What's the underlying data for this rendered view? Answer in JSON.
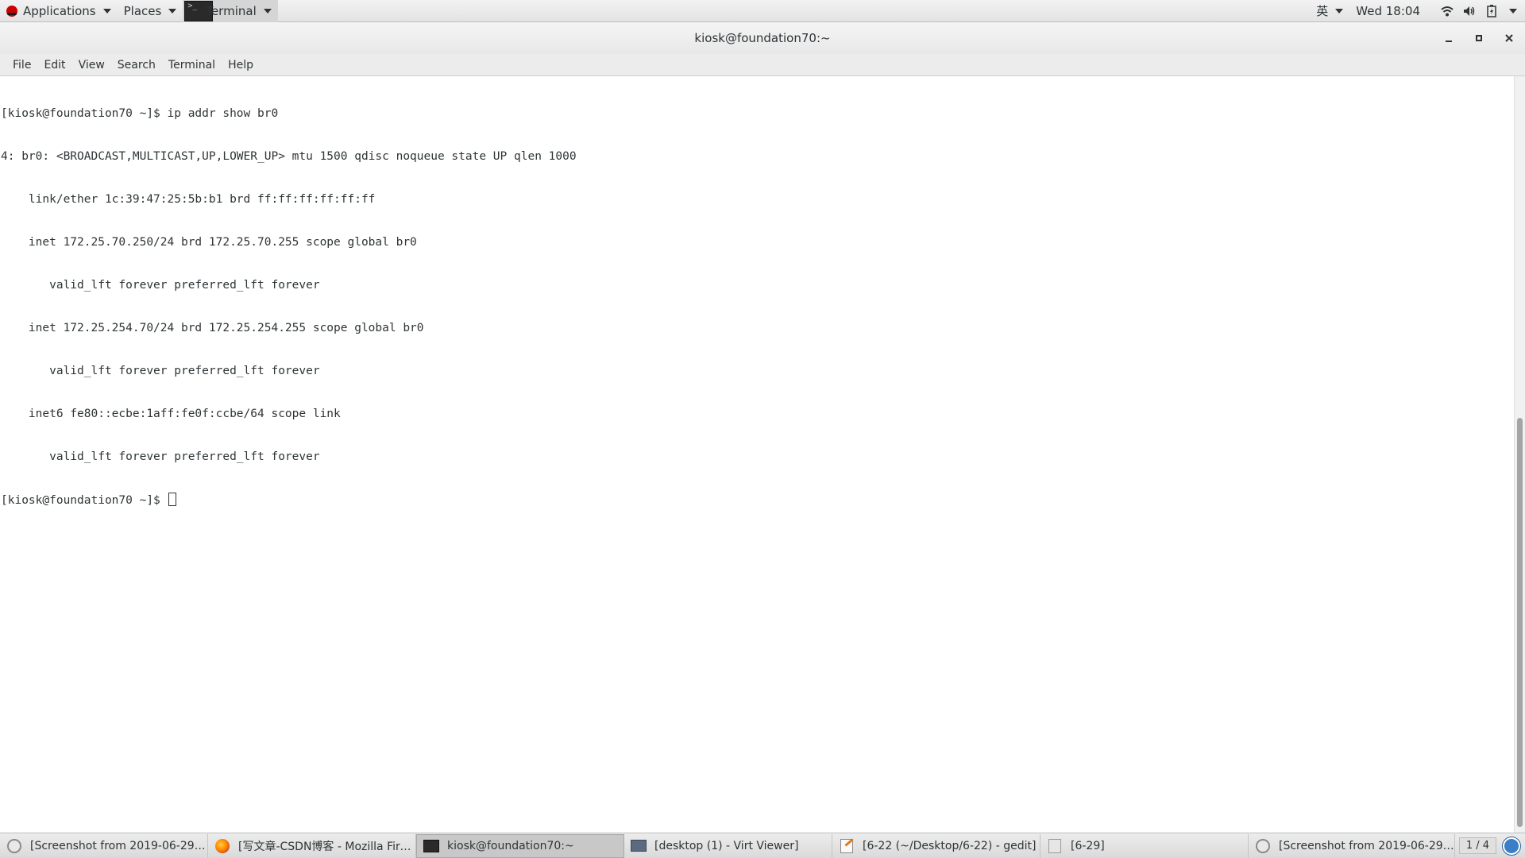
{
  "top_panel": {
    "applications_label": "Applications",
    "places_label": "Places",
    "terminal_label": "Terminal",
    "terminal_icon_text": ">_",
    "input_method": "英",
    "clock": "Wed 18:04",
    "icons": [
      "redhat-icon",
      "wifi-icon",
      "volume-icon",
      "battery-icon",
      "power-menu-icon"
    ]
  },
  "window": {
    "title": "kiosk@foundation70:~"
  },
  "menubar": {
    "file": "File",
    "edit": "Edit",
    "view": "View",
    "search": "Search",
    "terminal": "Terminal",
    "help": "Help"
  },
  "terminal": {
    "lines": [
      "[kiosk@foundation70 ~]$ ip addr show br0",
      "4: br0: <BROADCAST,MULTICAST,UP,LOWER_UP> mtu 1500 qdisc noqueue state UP qlen 1000",
      "    link/ether 1c:39:47:25:5b:b1 brd ff:ff:ff:ff:ff:ff",
      "    inet 172.25.70.250/24 brd 172.25.70.255 scope global br0",
      "       valid_lft forever preferred_lft forever",
      "    inet 172.25.254.70/24 brd 172.25.254.255 scope global br0",
      "       valid_lft forever preferred_lft forever",
      "    inet6 fe80::ecbe:1aff:fe0f:ccbe/64 scope link",
      "       valid_lft forever preferred_lft forever"
    ],
    "prompt": "[kiosk@foundation70 ~]$ "
  },
  "taskbar": {
    "tasks": [
      {
        "label": "[Screenshot from 2019-06-29 ...",
        "icon": "screenshot-icon"
      },
      {
        "label": "[写文章-CSDN博客 - Mozilla Fire...",
        "icon": "firefox-icon"
      },
      {
        "label": "kiosk@foundation70:~",
        "icon": "terminal-icon",
        "active": true
      },
      {
        "label": "[desktop (1) - Virt Viewer]",
        "icon": "virt-viewer-icon"
      },
      {
        "label": "[6-22 (~/Desktop/6-22) - gedit]",
        "icon": "gedit-icon"
      },
      {
        "label": "[6-29]",
        "icon": "folder-icon"
      },
      {
        "label": "[Screenshot from 2019-06-29 ...",
        "icon": "screenshot-icon"
      }
    ],
    "workspace": "1 / 4"
  }
}
